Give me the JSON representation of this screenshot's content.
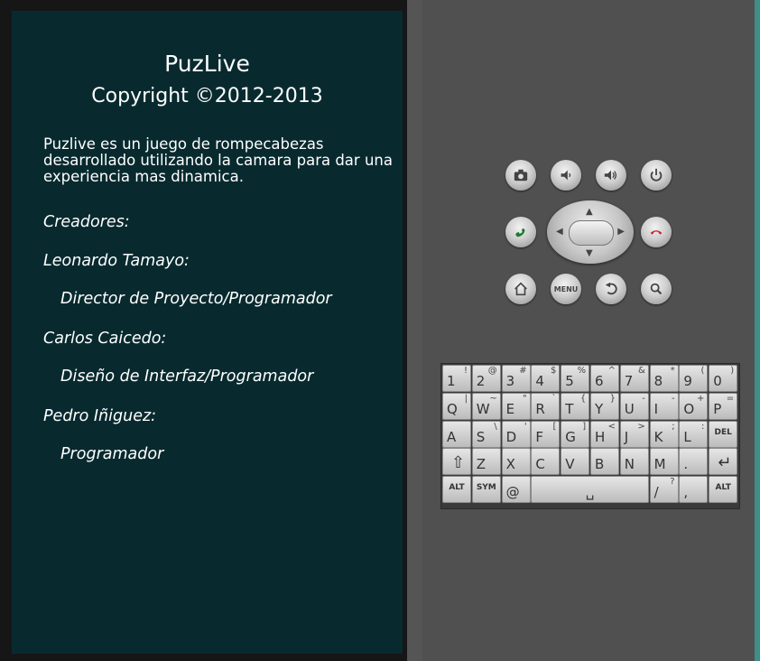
{
  "app": {
    "title": "PuzLive",
    "copyright": "Copyright ©2012-2013",
    "description": "Puzlive es un juego de rompecabezas desarrollado utilizando la camara para dar una experiencia mas dinamica.",
    "creators_heading": "Creadores:",
    "creators": [
      {
        "name": "Leonardo Tamayo:",
        "role": "Director de Proyecto/Programador"
      },
      {
        "name": "Carlos Caicedo:",
        "role": "Diseño de Interfaz/Programador"
      },
      {
        "name": "Pedro Iñiguez:",
        "role": "Programador"
      }
    ]
  },
  "hardware": {
    "menu_label": "MENU",
    "icons": [
      "camera-icon",
      "volume-down-icon",
      "volume-up-icon",
      "power-icon",
      "call-icon",
      "end-call-icon",
      "home-icon",
      "back-icon",
      "search-icon"
    ]
  },
  "keyboard": {
    "row1": [
      [
        "1",
        "!"
      ],
      [
        "2",
        "@"
      ],
      [
        "3",
        "#"
      ],
      [
        "4",
        "$"
      ],
      [
        "5",
        "%"
      ],
      [
        "6",
        "^"
      ],
      [
        "7",
        "&"
      ],
      [
        "8",
        "*"
      ],
      [
        "9",
        "("
      ],
      [
        "0",
        ")"
      ]
    ],
    "row2": [
      [
        "Q",
        "|"
      ],
      [
        "W",
        "~"
      ],
      [
        "E",
        "\""
      ],
      [
        "R",
        "`"
      ],
      [
        "T",
        "{"
      ],
      [
        "Y",
        "}"
      ],
      [
        "U",
        "-"
      ],
      [
        "I",
        "-"
      ],
      [
        "O",
        "+"
      ],
      [
        "P",
        "="
      ]
    ],
    "row3": [
      [
        "A",
        ""
      ],
      [
        "S",
        "\\"
      ],
      [
        "D",
        "'"
      ],
      [
        "F",
        "["
      ],
      [
        "G",
        "]"
      ],
      [
        "H",
        "<"
      ],
      [
        "J",
        ">"
      ],
      [
        "K",
        ";"
      ],
      [
        "L",
        ":"
      ],
      [
        "DEL",
        ""
      ]
    ],
    "row4": [
      [
        "⇧",
        ""
      ],
      [
        "Z",
        ""
      ],
      [
        "X",
        ""
      ],
      [
        "C",
        ""
      ],
      [
        "V",
        ""
      ],
      [
        "B",
        ""
      ],
      [
        "N",
        ""
      ],
      [
        "M",
        ""
      ],
      [
        ".",
        ""
      ],
      [
        "↵",
        ""
      ]
    ],
    "row5": {
      "alt": "ALT",
      "sym": "SYM",
      "at": "@",
      "space": "␣",
      "slash": "/",
      "slash_sec": "?",
      "comma": ",",
      "alt2": "ALT"
    }
  }
}
